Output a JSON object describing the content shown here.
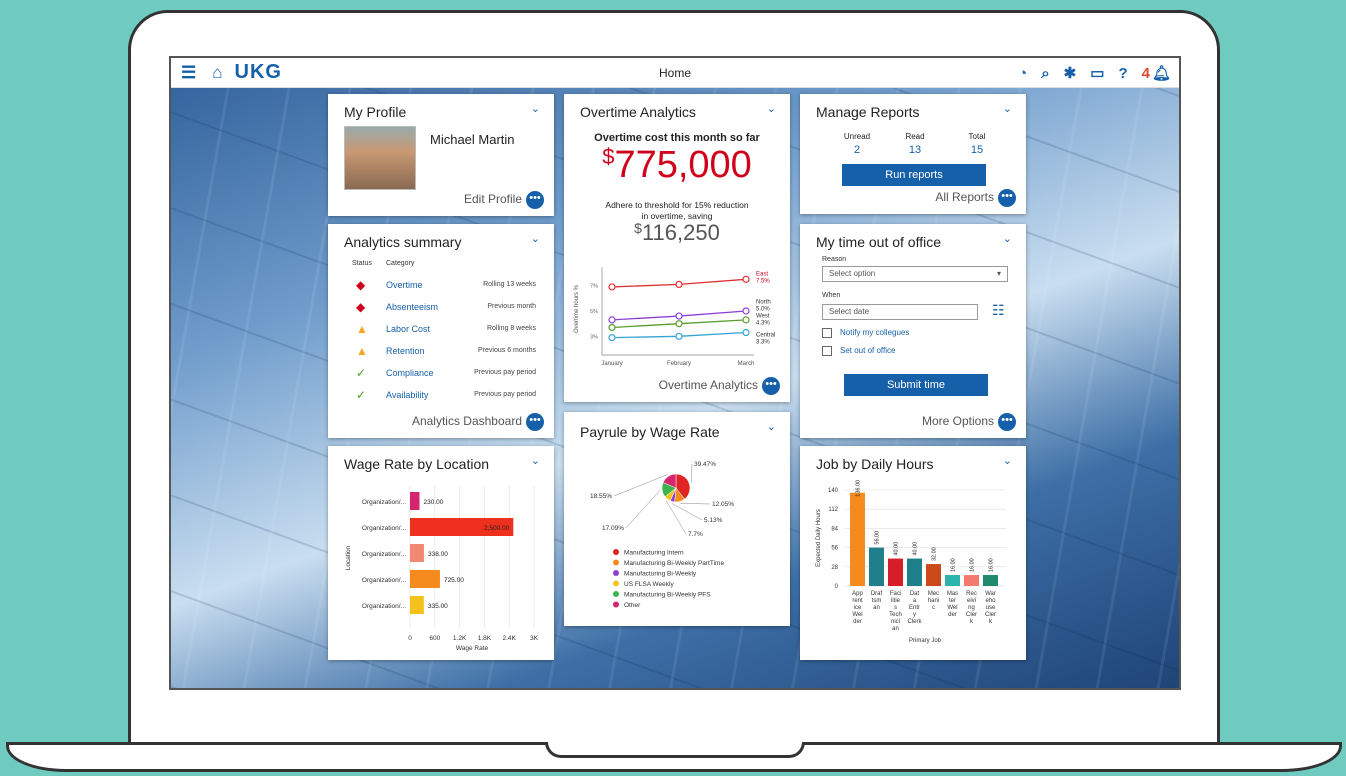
{
  "topbar": {
    "title": "Home",
    "logo": "UKG",
    "notif_count": "4",
    "icons": [
      "hamburger-icon",
      "home-icon",
      "timer-icon",
      "search-icon",
      "gear-icon",
      "message-icon",
      "help-icon",
      "bell-icon"
    ]
  },
  "profile": {
    "title": "My Profile",
    "name": "Michael Martin",
    "link": "Edit Profile"
  },
  "analytics": {
    "title": "Analytics summary",
    "col_status": "Status",
    "col_category": "Category",
    "rows": [
      {
        "cat": "Overtime",
        "period": "Rolling 13 weeks",
        "status": "red"
      },
      {
        "cat": "Absenteeism",
        "period": "Previous month",
        "status": "red"
      },
      {
        "cat": "Labor Cost",
        "period": "Rolling 8 weeks",
        "status": "yellow"
      },
      {
        "cat": "Retention",
        "period": "Previous 6 months",
        "status": "yellow"
      },
      {
        "cat": "Compliance",
        "period": "Previous pay period",
        "status": "green"
      },
      {
        "cat": "Availability",
        "period": "Previous pay period",
        "status": "green"
      }
    ],
    "link": "Analytics Dashboard"
  },
  "overtime": {
    "title": "Overtime Analytics",
    "subtitle": "Overtime cost this month so far",
    "currency": "$",
    "amount": "775,000",
    "note": "Adhere to threshold for 15% reduction in overtime, saving",
    "saving": "116,250",
    "link": "Overtime Analytics"
  },
  "reports": {
    "title": "Manage Reports",
    "unread_label": "Unread",
    "read_label": "Read",
    "total_label": "Total",
    "unread": "2",
    "read": "13",
    "total": "15",
    "button": "Run reports",
    "link": "All Reports"
  },
  "timeout": {
    "title": "My time out of office",
    "reason_label": "Reason",
    "reason_placeholder": "Select option",
    "when_label": "When",
    "date_placeholder": "Select date",
    "check1": "Notify my collegues",
    "check2": "Set out of office",
    "button": "Submit time",
    "link": "More Options"
  },
  "wage": {
    "title": "Wage Rate by Location"
  },
  "payrule": {
    "title": "Payrule by Wage Rate"
  },
  "jobhours": {
    "title": "Job by Daily Hours"
  },
  "chart_data": [
    {
      "type": "line",
      "ylabel": "Overtime hours %",
      "categories": [
        "January",
        "February",
        "March"
      ],
      "yticks": [
        "3%",
        "5%",
        "7%"
      ],
      "series": [
        {
          "name": "East",
          "label": "7.5%",
          "color": "#e03131",
          "values": [
            6.9,
            7.1,
            7.5
          ]
        },
        {
          "name": "North",
          "label": "5.0%",
          "color": "#8b3fd6",
          "values": [
            4.3,
            4.6,
            5.0
          ]
        },
        {
          "name": "West",
          "label": "4.3%",
          "color": "#5a9e2b",
          "values": [
            3.7,
            4.0,
            4.3
          ]
        },
        {
          "name": "Central",
          "label": "3.3%",
          "color": "#38a3d6",
          "values": [
            2.9,
            3.0,
            3.3
          ]
        }
      ]
    },
    {
      "type": "bar",
      "orientation": "horizontal",
      "categories": [
        "Organization/...",
        "Organization/...",
        "Organization/...",
        "Organization/...",
        "Organization/..."
      ],
      "values": [
        230,
        2500,
        338,
        725,
        335
      ],
      "value_labels": [
        "230.00",
        "2,500.00",
        "338.00",
        "725.00",
        "335.00"
      ],
      "colors": [
        "#d6246e",
        "#f0301e",
        "#f28a73",
        "#f58a1f",
        "#f5c21b"
      ],
      "xlabel": "Wage Rate",
      "ylabel": "Location",
      "xticks": [
        "0",
        "600",
        "1.2K",
        "1.8K",
        "2.4K",
        "3K"
      ],
      "xlim": [
        0,
        3000
      ]
    },
    {
      "type": "pie",
      "slices": [
        {
          "name": "Manufacturing Intern",
          "value": 39.47,
          "label": "39.47%",
          "color": "#e02323"
        },
        {
          "name": "Manufacturing Bi-Weekly PartTime",
          "value": 12.05,
          "label": "12.05%",
          "color": "#f58a1f"
        },
        {
          "name": "Manufacturing Bi-Weekly",
          "value": 5.13,
          "label": "5.13%",
          "color": "#8b3fd6"
        },
        {
          "name": "US FLSA Weekly",
          "value": 7.7,
          "label": "7.7%",
          "color": "#f5c21b"
        },
        {
          "name": "Manufacturing Bi-Weekly PFS",
          "value": 17.09,
          "label": "17.09%",
          "color": "#3cb44b"
        },
        {
          "name": "Other",
          "value": 18.55,
          "label": "18.55%",
          "color": "#d6246e"
        }
      ]
    },
    {
      "type": "bar",
      "xlabel": "Primary Job",
      "ylabel": "Expected Daily Hours",
      "ylim": [
        0,
        140
      ],
      "yticks": [
        "0",
        "28",
        "56",
        "84",
        "112",
        "140"
      ],
      "categories": [
        "Apprentice Welder",
        "Draftsman",
        "Facilities Technician",
        "Data Entry Clerk",
        "Mechanic",
        "Master Welder",
        "Receiving Clerk",
        "Warehouse Clerk"
      ],
      "x_labels": [
        [
          "App",
          "rent",
          "ice",
          "Wel",
          "der"
        ],
        [
          "Draf",
          "tsm",
          "an"
        ],
        [
          "Faci",
          "litie",
          "s",
          "Tech",
          "nici",
          "an"
        ],
        [
          "Dat",
          "a",
          "Entr",
          "y",
          "Clerk"
        ],
        [
          "Mec",
          "hani",
          "c"
        ],
        [
          "Mas",
          "ter",
          "Wel",
          "der"
        ],
        [
          "Rec",
          "eivi",
          "ng",
          "Cler",
          "k"
        ],
        [
          "War",
          "eho",
          "use",
          "Cler",
          "k"
        ]
      ],
      "values": [
        136,
        56,
        40,
        40,
        32,
        16,
        16,
        16
      ],
      "value_labels": [
        "136.00",
        "56.00",
        "40.00",
        "40.00",
        "32.00",
        "16.00",
        "16.00",
        "16.00"
      ],
      "colors": [
        "#f58a1f",
        "#1f7f8a",
        "#d61e2b",
        "#1f7f8a",
        "#cc4a1a",
        "#2bb3ac",
        "#f27a6e",
        "#1f8a6b"
      ]
    }
  ]
}
